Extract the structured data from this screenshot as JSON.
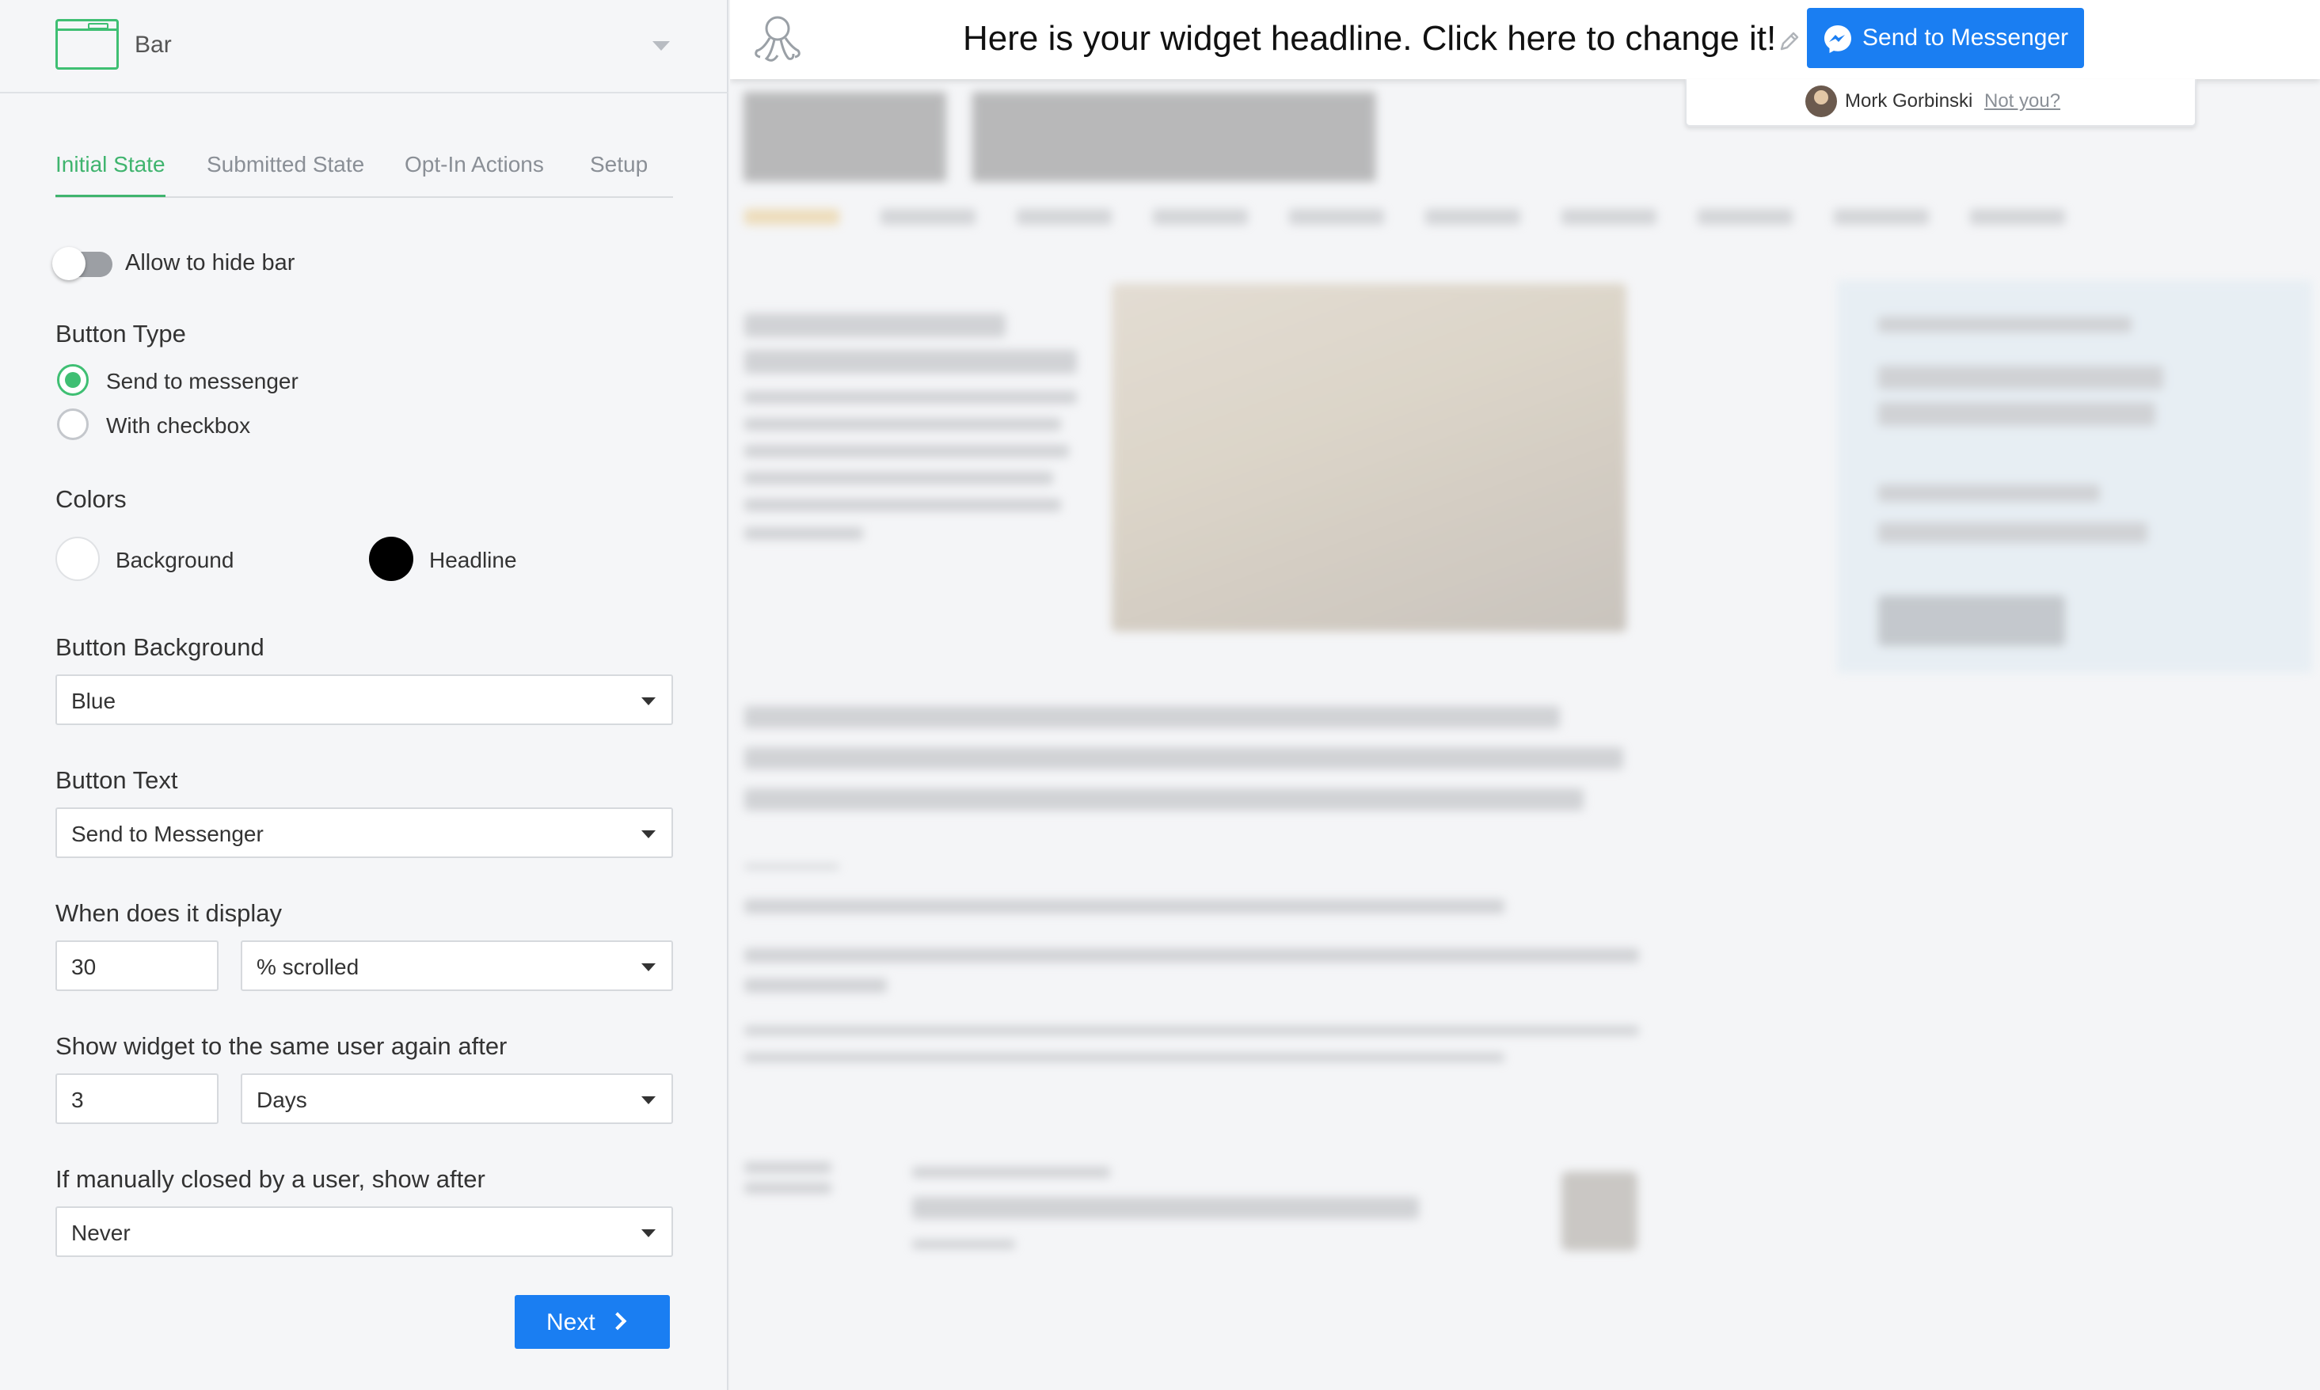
{
  "widget_selector": {
    "label": "Bar",
    "icon": "bar-widget-icon"
  },
  "tabs": [
    {
      "label": "Initial State",
      "active": true
    },
    {
      "label": "Submitted State",
      "active": false
    },
    {
      "label": "Opt-In Actions",
      "active": false
    },
    {
      "label": "Setup",
      "active": false
    }
  ],
  "hide_bar": {
    "label": "Allow to hide bar",
    "enabled": false
  },
  "button_type": {
    "title": "Button Type",
    "options": [
      {
        "label": "Send to messenger",
        "selected": true
      },
      {
        "label": "With checkbox",
        "selected": false
      }
    ]
  },
  "colors": {
    "title": "Colors",
    "background": {
      "label": "Background",
      "value": "#ffffff"
    },
    "headline": {
      "label": "Headline",
      "value": "#000000"
    }
  },
  "button_background": {
    "title": "Button Background",
    "value": "Blue"
  },
  "button_text": {
    "title": "Button Text",
    "value": "Send to Messenger"
  },
  "display": {
    "title": "When does it display",
    "amount": "30",
    "unit": "% scrolled"
  },
  "show_again": {
    "title": "Show widget to the same user again after",
    "amount": "3",
    "unit": "Days"
  },
  "manually_closed": {
    "title": "If manually closed by a user, show after",
    "value": "Never"
  },
  "next_button": {
    "label": "Next"
  },
  "preview": {
    "headline": "Here is your widget headline. Click here to change it!",
    "messenger_button": "Send to Messenger",
    "user_name": "Mork Gorbinski",
    "not_you": "Not you?"
  },
  "accent_colors": {
    "green": "#3fbf73",
    "blue": "#1a7ef2"
  }
}
